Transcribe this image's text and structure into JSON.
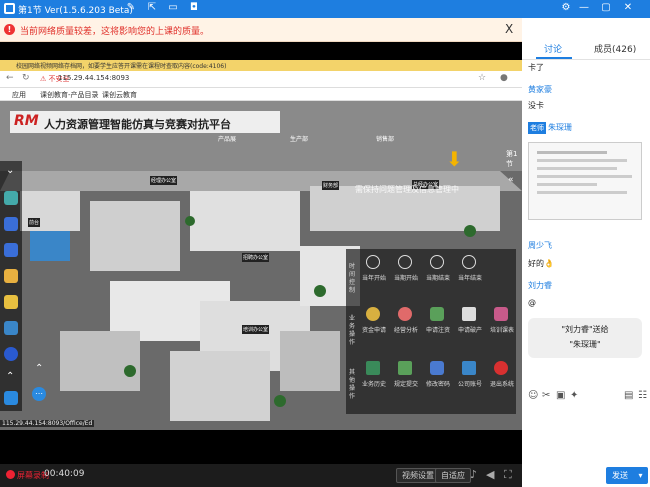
{
  "title_bar": {
    "title": "第1节 Ver(1.5.6.203 Beta)"
  },
  "warning": {
    "text": "当前网络质量较差，这将影响您的上课的质量。",
    "close": "X"
  },
  "browser": {
    "window_text": "校园网络视频网络存档网，如要学生应答开课需在课程时查取内容(code:4106)",
    "security": "⚠ 不安全",
    "url": "115.29.44.154:8093",
    "bookmarks": [
      "应用",
      "课创教育-产品目录",
      "课创云教育"
    ],
    "status_url": "115.29.44.154:8093/Office/Ed"
  },
  "scene": {
    "banner": "人力资源管理智能仿真与竞赛对抗平台",
    "brand": "RM",
    "overlay_caption": "需保持问题管理及信息管理中",
    "room_labels": [
      "经理办公室",
      "总经办公室",
      "财务部",
      "前台",
      "招聘办公室",
      "培训办公室",
      "绩效办公室"
    ],
    "top_labels": [
      "产品展",
      "生产部",
      "销售部"
    ],
    "right_tab": "第1节",
    "menu": {
      "time_section": "时间控制",
      "time_items": [
        "当年开始",
        "当期开始",
        "当期结束",
        "当年结束"
      ],
      "biz_section": "业务操作",
      "biz_items": [
        "资金申请",
        "经营分析",
        "申请注资",
        "申请破产",
        "培训课表"
      ],
      "other_section": "其他操作",
      "other_items": [
        "业务历史",
        "规定提交",
        "修改密码",
        "公司账号",
        "退出系统"
      ]
    }
  },
  "controls": {
    "record_label": "屏幕录制",
    "time": "00:40:09",
    "btn_settings": "视频设置",
    "btn_fit": "自适应"
  },
  "chat": {
    "tab_discussion": "讨论",
    "tab_members": "成员(426)",
    "messages": [
      {
        "name": "",
        "text": "卡了"
      },
      {
        "name": "黄家豪",
        "text": "没卡"
      },
      {
        "name": "朱琛珊",
        "text": "",
        "badge": "老师"
      },
      {
        "name": "周少飞",
        "text": "好的👌"
      },
      {
        "name": "刘力睿",
        "text": "@"
      }
    ],
    "gift_line1": "\"刘力睿\"送给",
    "gift_line2": "\"朱琛珊\"",
    "send": "发送"
  },
  "colors": {
    "accent": "#1e7ee0",
    "warning": "#e0302a",
    "record": "#e22233"
  }
}
